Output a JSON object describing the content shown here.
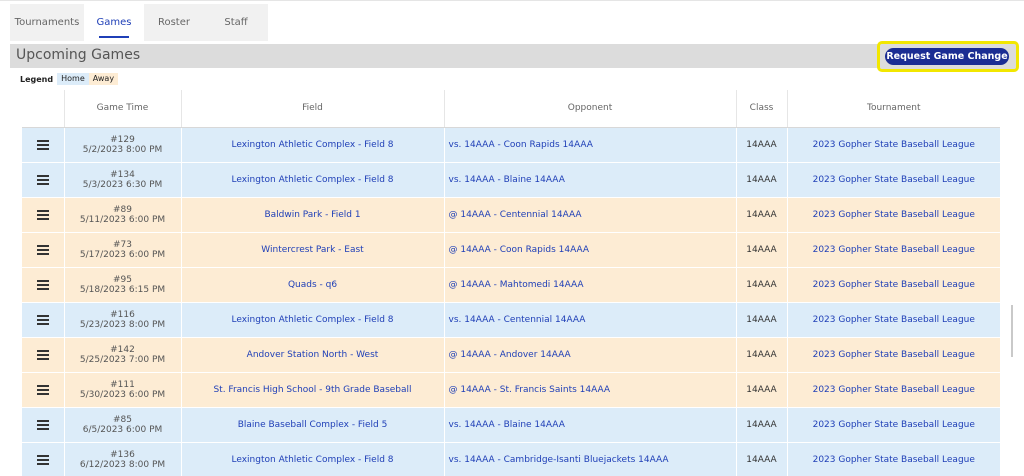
{
  "tabs": [
    {
      "label": "Tournaments",
      "active": false
    },
    {
      "label": "Games",
      "active": true
    },
    {
      "label": "Roster",
      "active": false
    },
    {
      "label": "Staff",
      "active": false
    }
  ],
  "section": {
    "title": "Upcoming Games",
    "request_button": "Request Game Change"
  },
  "legend": {
    "label": "Legend",
    "home": "Home",
    "away": "Away"
  },
  "colors": {
    "home": "#dcecf9",
    "away": "#fdecd4",
    "accent": "#1b2d93",
    "link": "#1f3fb7",
    "highlight": "#f2e700"
  },
  "table": {
    "columns": [
      "",
      "Game Time",
      "Field",
      "Opponent",
      "Class",
      "Tournament"
    ],
    "rows": [
      {
        "type": "home",
        "icon": "menu-icon",
        "game_no": "#129",
        "datetime": "5/2/2023 8:00 PM",
        "field": "Lexington Athletic Complex - Field 8",
        "opponent": "vs. 14AAA - Coon Rapids 14AAA",
        "class": "14AAA",
        "tournament": "2023 Gopher State Baseball League"
      },
      {
        "type": "home",
        "icon": "menu-icon",
        "game_no": "#134",
        "datetime": "5/3/2023 6:30 PM",
        "field": "Lexington Athletic Complex - Field 8",
        "opponent": "vs. 14AAA - Blaine 14AAA",
        "class": "14AAA",
        "tournament": "2023 Gopher State Baseball League"
      },
      {
        "type": "away",
        "icon": "menu-icon",
        "game_no": "#89",
        "datetime": "5/11/2023 6:00 PM",
        "field": "Baldwin Park - Field 1",
        "opponent": "@ 14AAA - Centennial 14AAA",
        "class": "14AAA",
        "tournament": "2023 Gopher State Baseball League"
      },
      {
        "type": "away",
        "icon": "menu-icon",
        "game_no": "#73",
        "datetime": "5/17/2023 6:00 PM",
        "field": "Wintercrest Park - East",
        "opponent": "@ 14AAA - Coon Rapids 14AAA",
        "class": "14AAA",
        "tournament": "2023 Gopher State Baseball League"
      },
      {
        "type": "away",
        "icon": "menu-icon",
        "game_no": "#95",
        "datetime": "5/18/2023 6:15 PM",
        "field": "Quads - q6",
        "opponent": "@ 14AAA - Mahtomedi 14AAA",
        "class": "14AAA",
        "tournament": "2023 Gopher State Baseball League"
      },
      {
        "type": "home",
        "icon": "menu-icon",
        "game_no": "#116",
        "datetime": "5/23/2023 8:00 PM",
        "field": "Lexington Athletic Complex - Field 8",
        "opponent": "vs. 14AAA - Centennial 14AAA",
        "class": "14AAA",
        "tournament": "2023 Gopher State Baseball League"
      },
      {
        "type": "away",
        "icon": "menu-icon",
        "game_no": "#142",
        "datetime": "5/25/2023 7:00 PM",
        "field": "Andover Station North - West",
        "opponent": "@ 14AAA - Andover 14AAA",
        "class": "14AAA",
        "tournament": "2023 Gopher State Baseball League"
      },
      {
        "type": "away",
        "icon": "menu-icon",
        "game_no": "#111",
        "datetime": "5/30/2023 6:00 PM",
        "field": "St. Francis High School - 9th Grade Baseball",
        "opponent": "@ 14AAA - St. Francis Saints 14AAA",
        "class": "14AAA",
        "tournament": "2023 Gopher State Baseball League"
      },
      {
        "type": "home",
        "icon": "menu-icon",
        "game_no": "#85",
        "datetime": "6/5/2023 6:00 PM",
        "field": "Blaine Baseball Complex - Field 5",
        "opponent": "vs. 14AAA - Blaine 14AAA",
        "class": "14AAA",
        "tournament": "2023 Gopher State Baseball League"
      },
      {
        "type": "home",
        "icon": "menu-icon",
        "game_no": "#136",
        "datetime": "6/12/2023 8:00 PM",
        "field": "Lexington Athletic Complex - Field 8",
        "opponent": "vs. 14AAA - Cambridge-Isanti Bluejackets 14AAA",
        "class": "14AAA",
        "tournament": "2023 Gopher State Baseball League"
      }
    ]
  }
}
